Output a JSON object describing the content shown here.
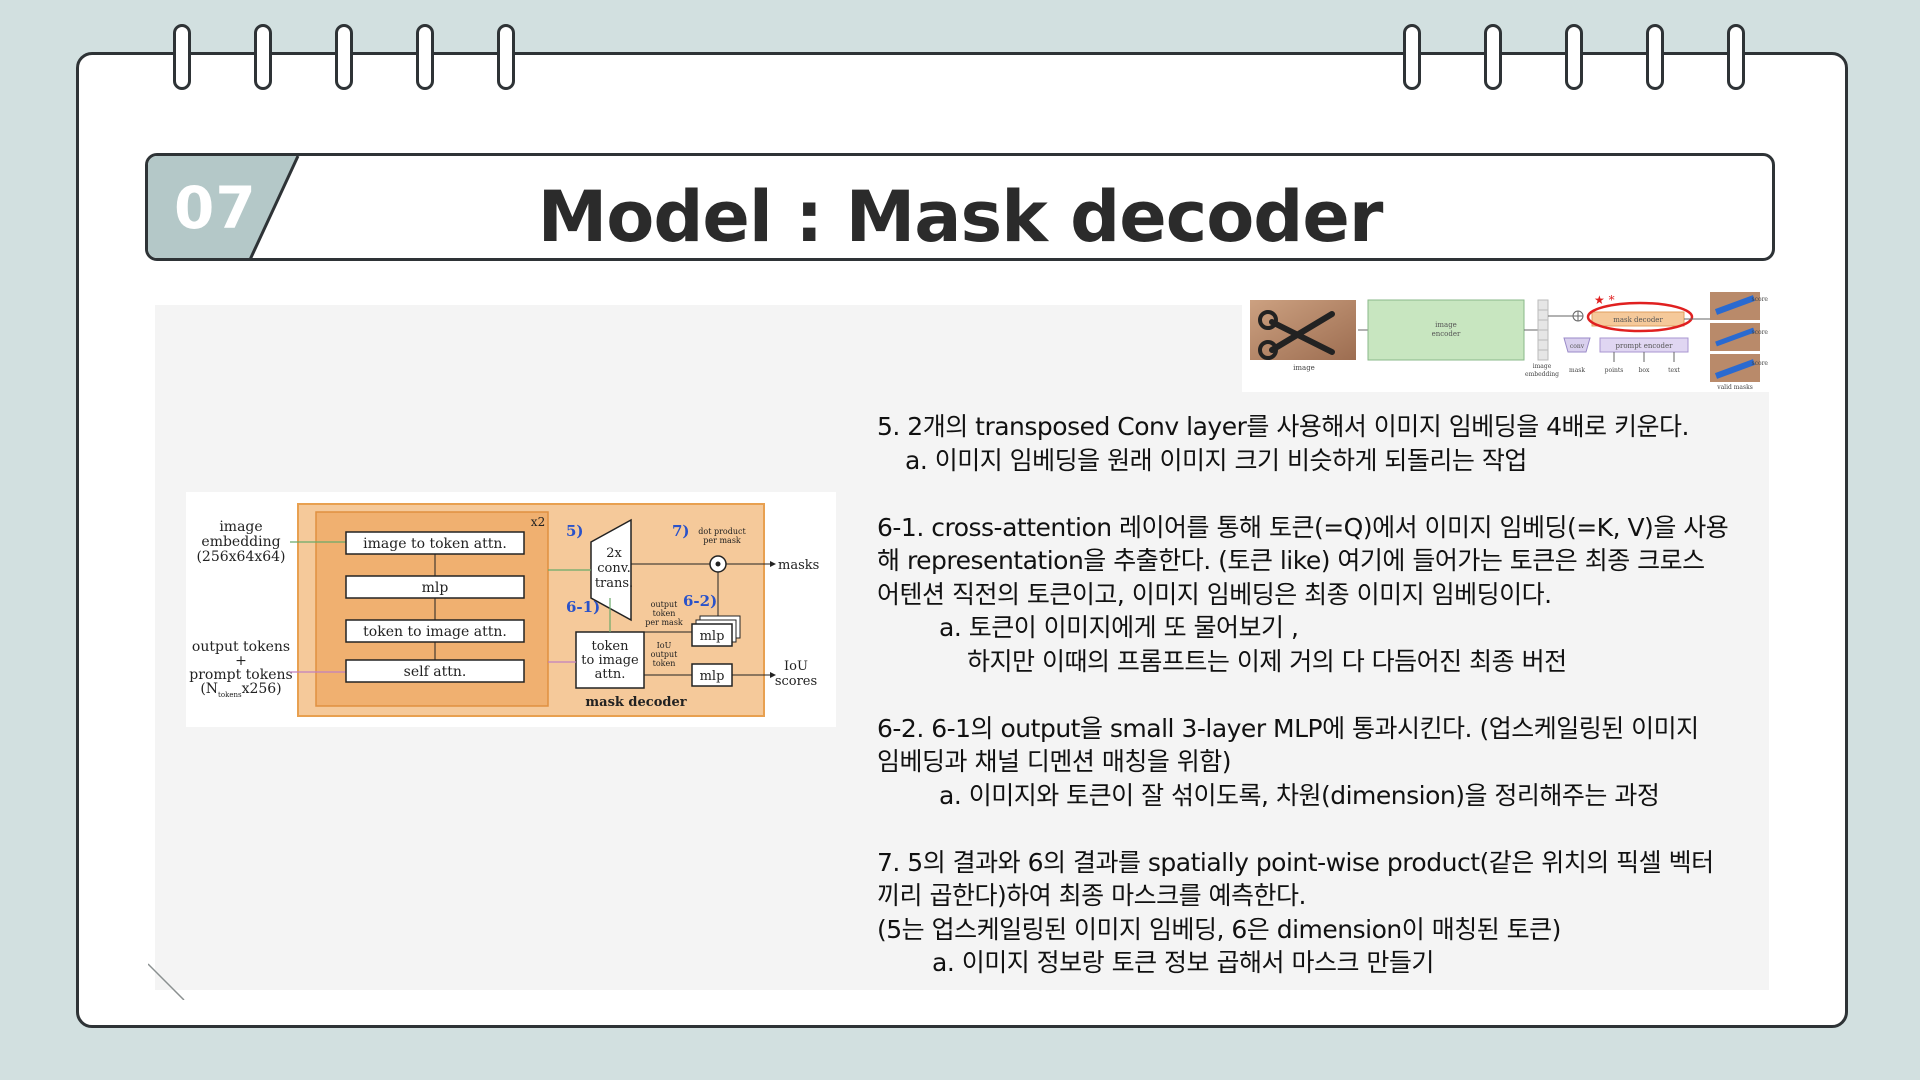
{
  "section": {
    "number": "07",
    "title": "Model :  Mask decoder"
  },
  "pipeline_diagram": {
    "image_label": "image",
    "encoder_label_1": "image",
    "encoder_label_2": "encoder",
    "embedding_label_1": "image",
    "embedding_label_2": "embedding",
    "conv_label": "conv",
    "mask_decoder_label": "mask decoder",
    "prompt_encoder_label": "prompt encoder",
    "mask_label": "mask",
    "points_label": "points",
    "box_label": "box",
    "text_label": "text",
    "score_label": "score",
    "valid_masks_label": "valid masks"
  },
  "decoder_diagram": {
    "image_embedding_1": "image",
    "image_embedding_2": "embedding",
    "image_embedding_3": "(256x64x64)",
    "output_tokens": "output tokens",
    "plus": "+",
    "prompt_tokens": "prompt tokens",
    "ntokens": "(N",
    "ntokens_sub": "tokens",
    "ntokens_end": "x256)",
    "x2": "x2",
    "block_image_to_token": "image to token attn.",
    "block_mlp": "mlp",
    "block_token_to_image": "token to image attn.",
    "block_self_attn": "self attn.",
    "step5": "5)",
    "step61": "6-1)",
    "step62": "6-2)",
    "step7": "7)",
    "conv_1": "2x",
    "conv_2": "conv.",
    "conv_3": "trans.",
    "dot_1": "dot product",
    "dot_2": "per mask",
    "masks": "masks",
    "token_attn_1": "token",
    "token_attn_2": "to image",
    "token_attn_3": "attn.",
    "out_tok_1": "output",
    "out_tok_2": "token",
    "out_tok_3": "per mask",
    "iou_1": "IoU",
    "iou_2": "output",
    "iou_3": "token",
    "mlp_a": "mlp",
    "mlp_b": "mlp",
    "iou_scores_1": "IoU",
    "iou_scores_2": "scores",
    "mask_decoder": "mask decoder"
  },
  "notes": [
    "5.  2개의 transposed Conv layer를 사용해서 이미지 임베딩을 4배로 키운다.",
    "a. 이미지 임베딩을 원래 이미지 크기 비슷하게 되돌리는 작업",
    "6-1. cross-attention 레이어를 통해 토큰(=Q)에서 이미지 임베딩(=K, V)을 사용",
    "해 representation을 추출한다. (토큰 like) 여기에 들어가는 토큰은 최종 크로스",
    "어텐션 직전의 토큰이고, 이미지 임베딩은 최종 이미지 임베딩이다.",
    "a. 토큰이 이미지에게 또 물어보기 ,",
    "하지만 이때의 프롬프트는 이제 거의 다 다듬어진 최종 버전",
    "6-2. 6-1의 output을 small 3-layer MLP에 통과시킨다. (업스케일링된 이미지",
    "임베딩과 채널 디멘션 매칭을 위함)",
    "a. 이미지와 토큰이 잘 섞이도록, 차원(dimension)을 정리해주는 과정",
    "7. 5의 결과와 6의 결과를 spatially point-wise product(같은 위치의 픽셀 벡터",
    "끼리 곱한다)하여 최종 마스크를 예측한다.",
    "(5는 업스케일링된 이미지 임베딩, 6은 dimension이 매칭된 토큰)",
    "a. 이미지 정보랑 토큰 정보 곱해서 마스크 만들기"
  ],
  "colors": {
    "background": "#d2e0e0",
    "tab": "#b4c8c8",
    "outline": "#2e3336",
    "decoder_fill": "#f5c99a",
    "step_blue": "#2a52c9"
  }
}
